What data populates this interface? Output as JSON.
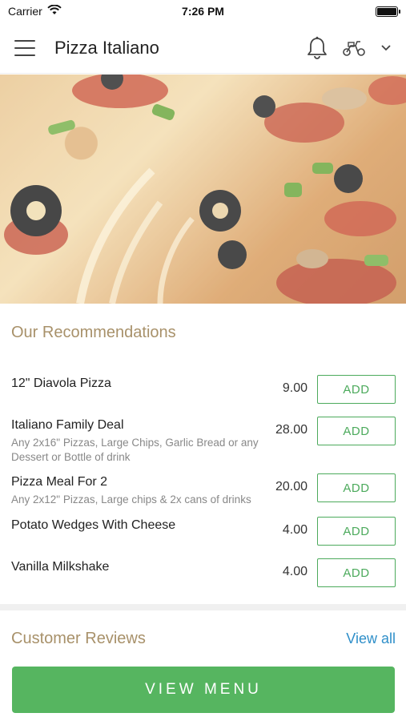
{
  "status_bar": {
    "carrier": "Carrier",
    "time": "7:26 PM"
  },
  "header": {
    "title": "Pizza Italiano",
    "icons": [
      "hamburger-menu-icon",
      "bell-icon",
      "scooter-icon",
      "chevron-down-icon"
    ]
  },
  "recommendations": {
    "title": "Our Recommendations",
    "items": [
      {
        "name": "12\" Diavola Pizza",
        "desc": "",
        "price": "9.00",
        "button": "ADD"
      },
      {
        "name": "Italiano Family Deal",
        "desc": "Any 2x16\" Pizzas, Large Chips, Garlic Bread or any Dessert  or Bottle of drink",
        "price": "28.00",
        "button": "ADD"
      },
      {
        "name": "Pizza Meal For 2",
        "desc": "Any 2x12\" Pizzas, Large chips & 2x cans of drinks",
        "price": "20.00",
        "button": "ADD"
      },
      {
        "name": "Potato Wedges With Cheese",
        "desc": "",
        "price": "4.00",
        "button": "ADD"
      },
      {
        "name": "Vanilla Milkshake",
        "desc": "",
        "price": "4.00",
        "button": "ADD"
      }
    ]
  },
  "reviews": {
    "title": "Customer Reviews",
    "view_all": "View all"
  },
  "footer": {
    "button": "VIEW MENU"
  },
  "colors": {
    "accent_green": "#56b560",
    "section_title": "#a8916a",
    "link_blue": "#2f8fc9"
  }
}
